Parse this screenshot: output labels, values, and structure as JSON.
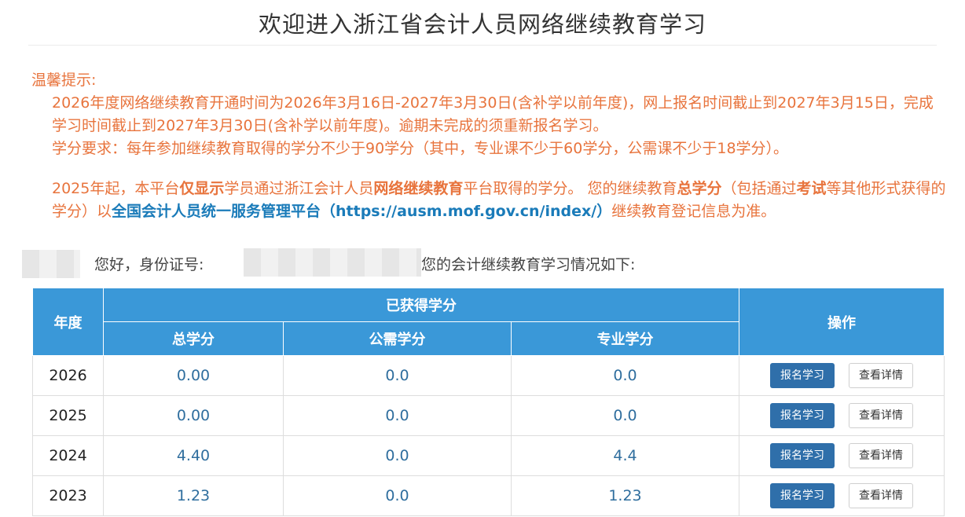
{
  "header": {
    "title": "欢迎进入浙江省会计人员网络继续教育学习"
  },
  "notice": {
    "heading": "温馨提示:",
    "line1": "2026年度网络继续教育开通时间为2026年3月16日-2027年3月30日(含补学以前年度)，网上报名时间截止到2027年3月15日，完成学习时间截止到2027年3月30日(含补学以前年度)。逾期未完成的须重新报名学习。",
    "line2": "学分要求：每年参加继续教育取得的学分不少于90学分（其中，专业课不少于60学分，公需课不少于18学分）。"
  },
  "statement": {
    "p1": "2025年起，本平台",
    "b1": "仅显示",
    "p2": "学员通过浙江会计人员",
    "b2": "网络继续教育",
    "p3": "平台取得的学分。 您的继续教育",
    "b3": "总学分",
    "p4": "（包括通过",
    "b4": "考试",
    "p5": "等其他形式获得的学分）以",
    "link": "全国会计人员统一服务管理平台（https://ausm.mof.gov.cn/index/）",
    "p6": "继续教育登记信息为准。"
  },
  "greeting": {
    "hello": "您好，身份证号:",
    "suffix": "您的会计继续教育学习情况如下:"
  },
  "table": {
    "headers": {
      "year": "年度",
      "earned": "已获得学分",
      "total": "总学分",
      "public": "公需学分",
      "professional": "专业学分",
      "actions": "操作"
    },
    "rows": [
      {
        "year": "2026",
        "total": "0.00",
        "public": "0.0",
        "professional": "0.0"
      },
      {
        "year": "2025",
        "total": "0.00",
        "public": "0.0",
        "professional": "0.0"
      },
      {
        "year": "2024",
        "total": "4.40",
        "public": "0.0",
        "professional": "4.4"
      },
      {
        "year": "2023",
        "total": "1.23",
        "public": "0.0",
        "professional": "1.23"
      }
    ],
    "buttons": {
      "sign": "报名学习",
      "detail": "查看详情"
    }
  },
  "colors": {
    "accent": "#3a98d8",
    "notice": "#e8743d",
    "button": "#2f6faa",
    "link": "#1a7bb9"
  }
}
